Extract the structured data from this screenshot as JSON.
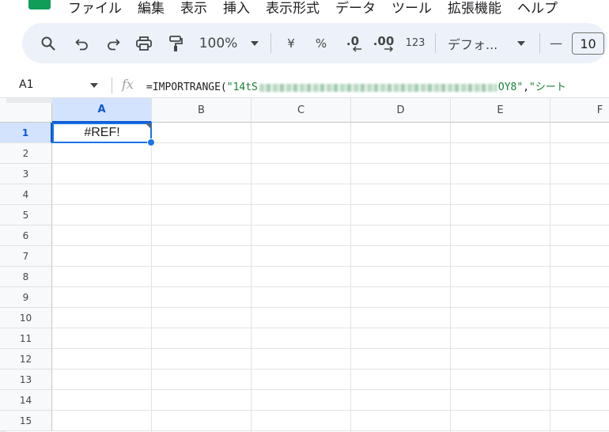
{
  "menubar": {
    "items": [
      "ファイル",
      "編集",
      "表示",
      "挿入",
      "表示形式",
      "データ",
      "ツール",
      "拡張機能",
      "ヘルプ"
    ]
  },
  "toolbar": {
    "zoom": "100%",
    "currency": "¥",
    "percent": "%",
    "decrease_decimal": ".0",
    "increase_decimal": ".00",
    "number_format": "123",
    "font_name": "デフォ...",
    "font_decrease": "—",
    "font_size": "10"
  },
  "formula_bar": {
    "name_box": "A1",
    "fx": "fx",
    "formula_prefix": "=IMPORTRANGE(",
    "formula_arg1_start": "\"14tS",
    "formula_arg1_end": "OY8\"",
    "formula_comma": ",",
    "formula_arg2": "\"シート"
  },
  "grid": {
    "columns": [
      "A",
      "B",
      "C",
      "D",
      "E",
      "F"
    ],
    "rows": [
      "1",
      "2",
      "3",
      "4",
      "5",
      "6",
      "7",
      "8",
      "9",
      "10",
      "11",
      "12",
      "13",
      "14",
      "15"
    ],
    "selected_cell": {
      "column": "A",
      "row": "1"
    },
    "cell_a1_value": "#REF!"
  },
  "colors": {
    "accent": "#1a73e8",
    "selected_header": "#d3e3fd",
    "toolbar_bg": "#edf2fa",
    "logo": "#0f9d58",
    "formula_string": "#188038"
  },
  "icons": [
    "search-icon",
    "undo-icon",
    "redo-icon",
    "print-icon",
    "paint-format-icon",
    "dropdown-icon",
    "decrease-decimal-icon",
    "increase-decimal-icon",
    "fx-icon",
    "sheets-logo"
  ]
}
